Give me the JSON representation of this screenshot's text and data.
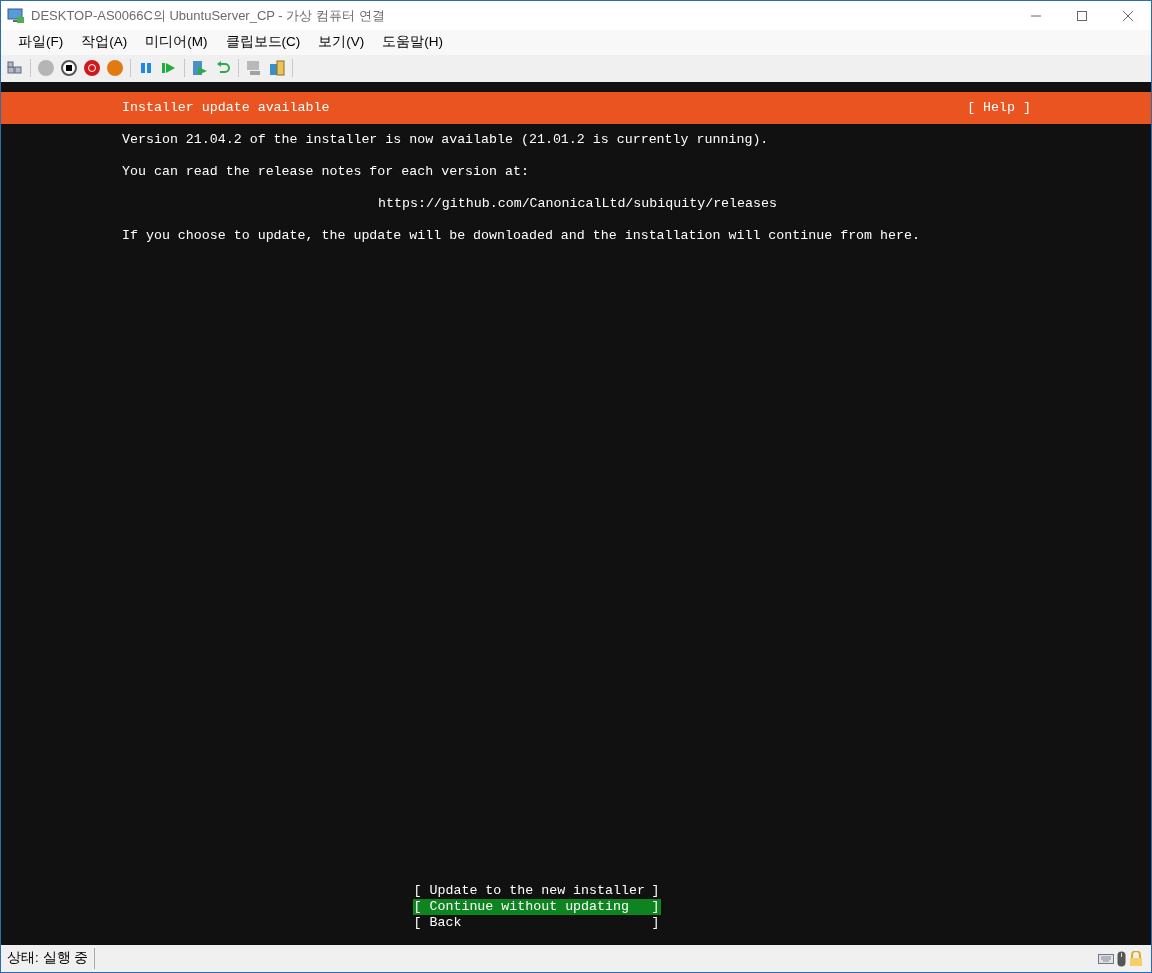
{
  "window": {
    "title": "DESKTOP-AS0066C의 UbuntuServer_CP - 가상 컴퓨터 연결"
  },
  "menu": [
    "파일(F)",
    "작업(A)",
    "미디어(M)",
    "클립보드(C)",
    "보기(V)",
    "도움말(H)"
  ],
  "header": {
    "title": "Installer update available",
    "help": "[ Help ]"
  },
  "body": [
    {
      "kind": "para",
      "text": "Version 21.04.2 of the installer is now available (21.01.2 is currently running)."
    },
    {
      "kind": "para",
      "text": "You can read the release notes for each version at:"
    },
    {
      "kind": "link",
      "text": "https://github.com/CanonicalLtd/subiquity/releases"
    },
    {
      "kind": "para",
      "text": "If you choose to update, the update will be downloaded and the installation will continue from here."
    }
  ],
  "buttons": [
    {
      "open": "[",
      "label": "Update to the new installer",
      "close": "]",
      "selected": false
    },
    {
      "open": "[",
      "label": "Continue without updating",
      "close": "]",
      "selected": true
    },
    {
      "open": "[",
      "label": "Back",
      "close": "]",
      "selected": false
    }
  ],
  "status_bar": {
    "text": "상태: 실행 중"
  }
}
